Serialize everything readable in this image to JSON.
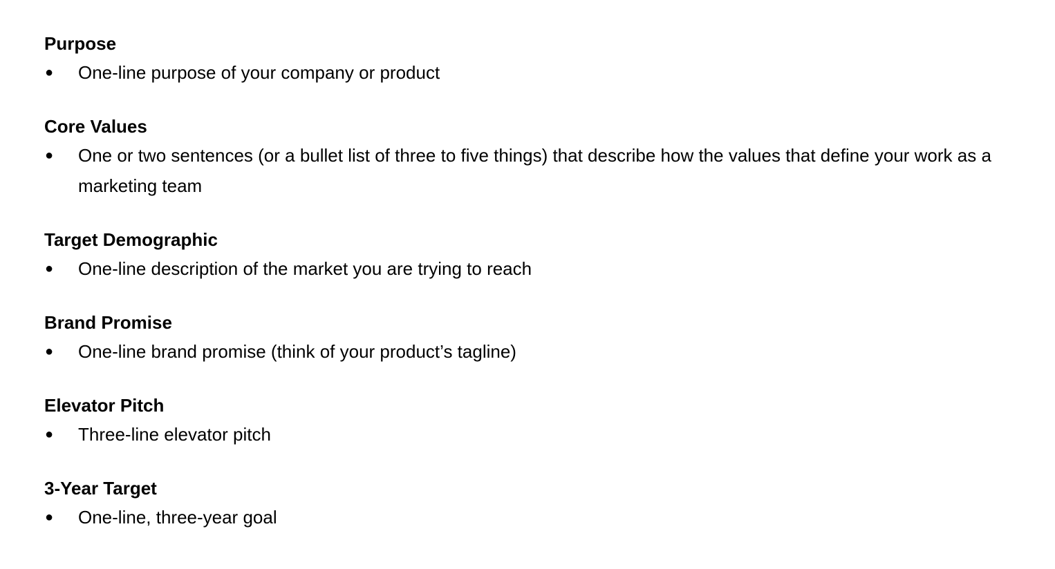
{
  "document": {
    "bullet_glyph": "●",
    "sections": [
      {
        "heading": "Purpose",
        "item": "One-line purpose of your company or product"
      },
      {
        "heading": "Core Values",
        "item": "One or two sentences (or a bullet list of three to five things) that describe how the values that define your work as a marketing team"
      },
      {
        "heading": "Target Demographic",
        "item": "One-line description of the market you are trying to reach"
      },
      {
        "heading": "Brand Promise",
        "item": "One-line brand promise (think of your product’s tagline)"
      },
      {
        "heading": "Elevator Pitch",
        "item": "Three-line elevator pitch"
      },
      {
        "heading": "3-Year Target",
        "item": "One-line, three-year goal"
      }
    ]
  }
}
